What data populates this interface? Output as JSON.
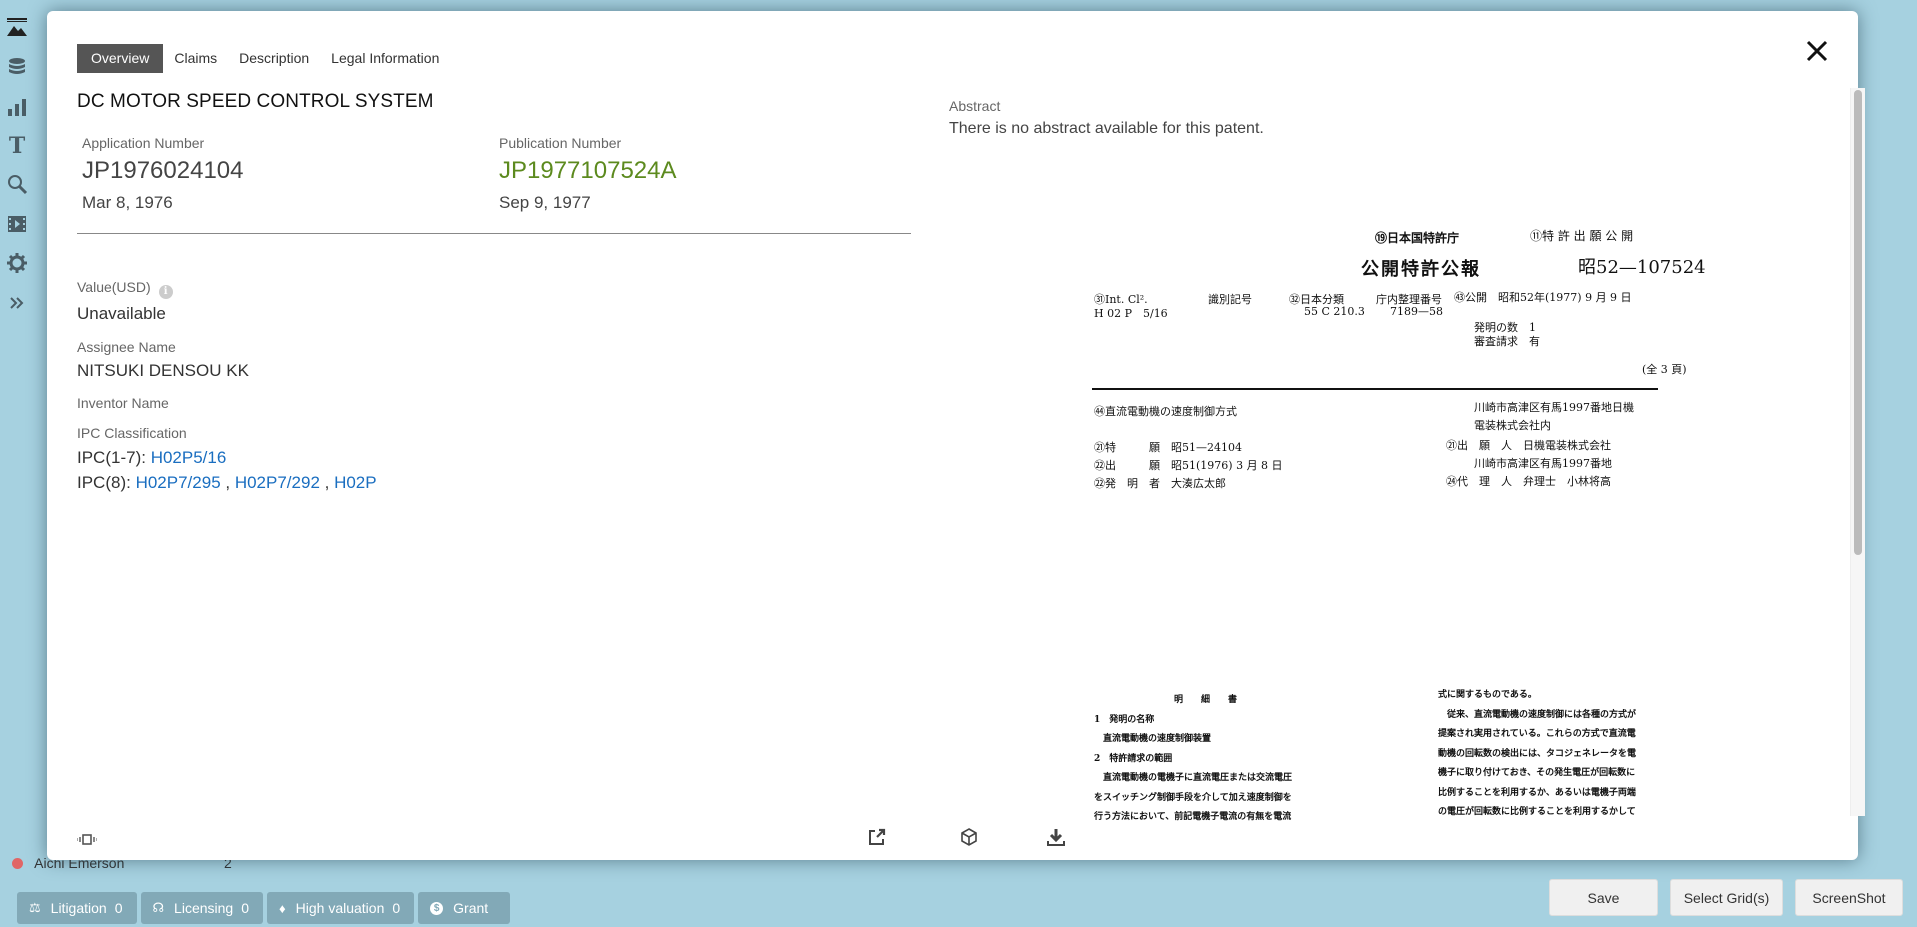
{
  "sidebar": {
    "icons": [
      "image-icon",
      "database-icon",
      "bar-chart-icon",
      "text-icon",
      "search-icon",
      "film-icon",
      "gear-icon",
      "expand-icon"
    ]
  },
  "tabs": [
    {
      "label": "Overview",
      "active": true
    },
    {
      "label": "Claims",
      "active": false
    },
    {
      "label": "Description",
      "active": false
    },
    {
      "label": "Legal Information",
      "active": false
    }
  ],
  "patent": {
    "title": "DC MOTOR SPEED CONTROL SYSTEM",
    "application": {
      "label": "Application Number",
      "number": "JP1976024104",
      "date": "Mar 8, 1976"
    },
    "publication": {
      "label": "Publication Number",
      "number": "JP1977107524A",
      "date": "Sep 9, 1977",
      "color": "#5c8a1e"
    },
    "value": {
      "label": "Value(USD)",
      "text": "Unavailable"
    },
    "assignee": {
      "label": "Assignee Name",
      "text": "NITSUKI DENSOU KK"
    },
    "inventor": {
      "label": "Inventor Name",
      "text": ""
    },
    "ipc": {
      "label": "IPC Classification",
      "ipc17_prefix": "IPC(1-7):",
      "ipc17": [
        "H02P5/16"
      ],
      "ipc8_prefix": "IPC(8):",
      "ipc8": [
        "H02P7/295",
        "H02P7/292",
        "H02P"
      ],
      "separator": " , "
    },
    "abstract": {
      "label": "Abstract",
      "text": "There is no abstract available for this patent."
    }
  },
  "document_image": {
    "office": "⑲日本国特許庁",
    "kind": "⑪特 許 出 願 公 開",
    "gazette": "公開特許公報",
    "pubno": "昭52—107524",
    "intcl_label": "㉛Int. Cl².",
    "intcl_value": "H 02 P　5/16",
    "id_label": "識別記号",
    "jpclass_label": "㉜日本分類",
    "jpclass_value": "55 C 210.3",
    "office_no_label": "庁内整理番号",
    "office_no_value": "7189—58",
    "pub_date": "㊸公開　昭和52年(1977) 9 月 9 日",
    "inventions": "発明の数　1",
    "exam": "審査請求　有",
    "pages": "(全 3 頁)",
    "invention_title": "㊹直流電動機の速度制御方式",
    "addr1": "川崎市高津区有馬1997番地日機",
    "addr2": "電装株式会社内",
    "app_no": "㉑特　　　願　昭51—24104",
    "filing": "㉒出　　　願　昭51(1976) 3 月 8 日",
    "inventor": "㉒発　明　者　大湊広太郎",
    "applicant": "㉑出　願　人　日機電装株式会社",
    "addr3": "川崎市高津区有馬1997番地",
    "agent": "㉔代　理　人　弁理士　小林将高",
    "body_left": [
      "明　　細　　書",
      "1　発明の名称",
      "　直流電動機の速度制御装置",
      "2　特許請求の範囲",
      "　直流電動機の電機子に直流電圧または交流電圧",
      "をスイッチング制御手段を介して加え速度制御を",
      "行う方法において、前記電機子電流の有無を電流"
    ],
    "body_right": [
      "式に関するものである。",
      "　従来、直流電動機の速度制御には各種の方式が",
      "提案され実用されている。これらの方式で直流電",
      "動機の回転数の検出には、タコジェネレータを電",
      "機子に取り付けておき、その発生電圧が回転数に",
      "比例することを利用するか、あるいは電機子両端",
      "の電圧が回転数に比例することを利用するかして"
    ]
  },
  "background_list": {
    "name": "Aichi Emerson",
    "count": "2",
    "dot_color": "#e06666"
  },
  "badges": [
    {
      "icon": "gavel-icon",
      "glyph": "⚖",
      "label": "Litigation",
      "count": "0"
    },
    {
      "icon": "ribbon-icon",
      "glyph": "☊",
      "label": "Licensing",
      "count": "0"
    },
    {
      "icon": "diamond-icon",
      "glyph": "♦",
      "label": "High valuation",
      "count": "0"
    },
    {
      "icon": "dollar-icon",
      "glyph": "$",
      "label": "Grant",
      "count": ""
    }
  ],
  "actions": {
    "save": "Save",
    "select_grid": "Select Grid(s)",
    "screenshot": "ScreenShot"
  }
}
